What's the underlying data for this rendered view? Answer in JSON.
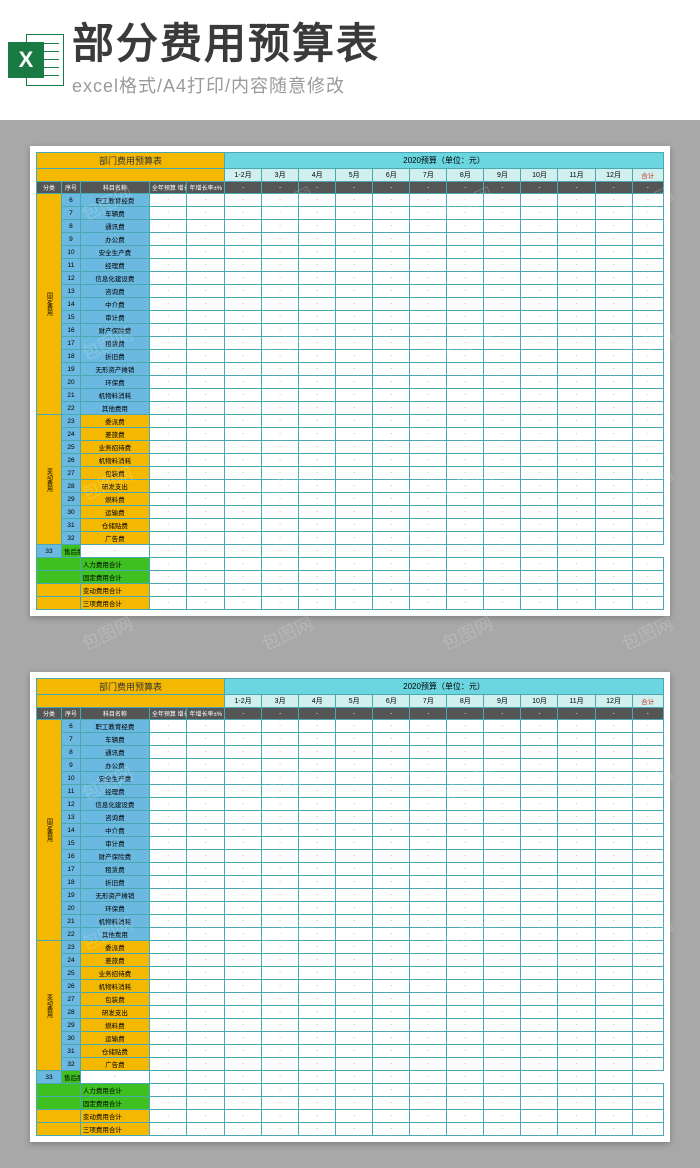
{
  "banner": {
    "icon_letter": "X",
    "title": "部分费用预算表",
    "subtitle": "excel格式/A4打印/内容随意修改"
  },
  "sheet": {
    "title": "部门费用预算表",
    "year_header": "2020预算（单位：元）",
    "sub_headers": {
      "cat": "分类",
      "id": "序号",
      "name": "科目名称",
      "annual": "全年预算 增长额±",
      "rate": "年增长率±%"
    },
    "months": [
      "1-2月",
      "3月",
      "4月",
      "5月",
      "6月",
      "7月",
      "8月",
      "9月",
      "10月",
      "11月",
      "12月"
    ],
    "total_label": "合计",
    "categories": [
      {
        "label": "固定费用",
        "span": 17,
        "bg": "#f5b800"
      },
      {
        "label": "变动费用",
        "span": 10,
        "bg": "#f5b800"
      }
    ],
    "rows": [
      {
        "id": 6,
        "name": "职工教育经费",
        "style": "blue"
      },
      {
        "id": 7,
        "name": "车辆费",
        "style": "blue"
      },
      {
        "id": 8,
        "name": "通讯费",
        "style": "blue"
      },
      {
        "id": 9,
        "name": "办公费",
        "style": "blue"
      },
      {
        "id": 10,
        "name": "安全生产费",
        "style": "blue"
      },
      {
        "id": 11,
        "name": "经理费",
        "style": "blue"
      },
      {
        "id": 12,
        "name": "信息化建设费",
        "style": "blue"
      },
      {
        "id": 13,
        "name": "咨询费",
        "style": "blue"
      },
      {
        "id": 14,
        "name": "中介费",
        "style": "blue"
      },
      {
        "id": 15,
        "name": "审计费",
        "style": "blue"
      },
      {
        "id": 16,
        "name": "财产保险费",
        "style": "blue"
      },
      {
        "id": 17,
        "name": "租赁费",
        "style": "blue"
      },
      {
        "id": 18,
        "name": "折旧费",
        "style": "blue"
      },
      {
        "id": 19,
        "name": "无形资产摊销",
        "style": "blue"
      },
      {
        "id": 20,
        "name": "环保费",
        "style": "blue"
      },
      {
        "id": 21,
        "name": "机物料消耗",
        "style": "blue"
      },
      {
        "id": 22,
        "name": "其他费用",
        "style": "blue"
      },
      {
        "id": 23,
        "name": "委派费",
        "style": "orange"
      },
      {
        "id": 24,
        "name": "差旅费",
        "style": "orange"
      },
      {
        "id": 25,
        "name": "业务招待费",
        "style": "orange"
      },
      {
        "id": 26,
        "name": "机物料消耗",
        "style": "orange"
      },
      {
        "id": 27,
        "name": "包装费",
        "style": "orange"
      },
      {
        "id": 28,
        "name": "研发支出",
        "style": "orange"
      },
      {
        "id": 29,
        "name": "燃料费",
        "style": "orange"
      },
      {
        "id": 30,
        "name": "运输费",
        "style": "orange"
      },
      {
        "id": 31,
        "name": "仓储贴费",
        "style": "orange"
      },
      {
        "id": 32,
        "name": "广告费",
        "style": "orange"
      },
      {
        "id": 33,
        "name": "售后服务费",
        "style": "green"
      }
    ],
    "summary_rows": [
      {
        "name": "人力费用合计",
        "bg": "#3ec020"
      },
      {
        "name": "固定费用合计",
        "bg": "#3ec020"
      },
      {
        "name": "变动费用合计",
        "bg": "#f5b800"
      },
      {
        "name": "三项费用合计",
        "bg": "#f5b800"
      }
    ]
  },
  "watermark_text": "包图网"
}
